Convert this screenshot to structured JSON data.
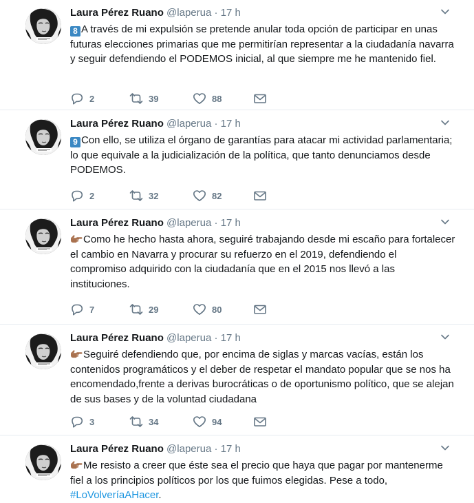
{
  "tweets": [
    {
      "name": "Laura Pérez Ruano",
      "handle": "@laperua",
      "time": "17 h",
      "keycap": "8",
      "text": "A través de mi expulsión se pretende anular toda opción de participar en unas futuras elecciones primarias que me permitirían representar a la ciudadanía navarra y seguir defendiendo el PODEMOS inicial, al que siempre me he mantenido fiel.",
      "replies": "2",
      "retweets": "39",
      "likes": "88"
    },
    {
      "name": "Laura Pérez Ruano",
      "handle": "@laperua",
      "time": "17 h",
      "keycap": "9",
      "text": "Con ello, se utiliza el órgano de garantías para atacar mi actividad parlamentaria; lo que equivale a la judicialización de la política, que tanto denunciamos desde PODEMOS.",
      "replies": "2",
      "retweets": "32",
      "likes": "82"
    },
    {
      "name": "Laura Pérez Ruano",
      "handle": "@laperua",
      "time": "17 h",
      "text": "Como he hecho hasta ahora, seguiré trabajando desde mi escaño para fortalecer el cambio en Navarra y procurar su refuerzo en el 2019, defendiendo el compromiso adquirido con la ciudadanía que en el 2015 nos llevó a las instituciones.",
      "replies": "7",
      "retweets": "29",
      "likes": "80"
    },
    {
      "name": "Laura Pérez Ruano",
      "handle": "@laperua",
      "time": "17 h",
      "text": "Seguiré defendiendo que, por encima de siglas y marcas vacías, están los contenidos programáticos y el deber de respetar el mandato popular que se nos ha encomendado,frente a derivas burocráticas o de oportunismo político, que se alejan de sus bases y de la voluntad ciudadana",
      "replies": "3",
      "retweets": "34",
      "likes": "94"
    },
    {
      "name": "Laura Pérez Ruano",
      "handle": "@laperua",
      "time": "17 h",
      "text": "Me resisto a creer que éste sea el precio que haya que pagar por mantenerme fiel a los principios políticos por los que fuimos elegidas. Pese a todo,",
      "hashtag": "#LoVolveríaAHacer",
      "text_end": "."
    }
  ],
  "icons": {
    "reply": "reply-icon",
    "retweet": "retweet-icon",
    "like": "heart-icon",
    "dm": "envelope-icon",
    "more": "chevron-down-icon",
    "point": "backhand-index-pointing-right-emoji"
  },
  "colors": {
    "text": "#14171a",
    "secondary": "#657786",
    "link": "#1b95e0",
    "keycap": "#3b88c3",
    "divider": "#e6ecf0"
  }
}
